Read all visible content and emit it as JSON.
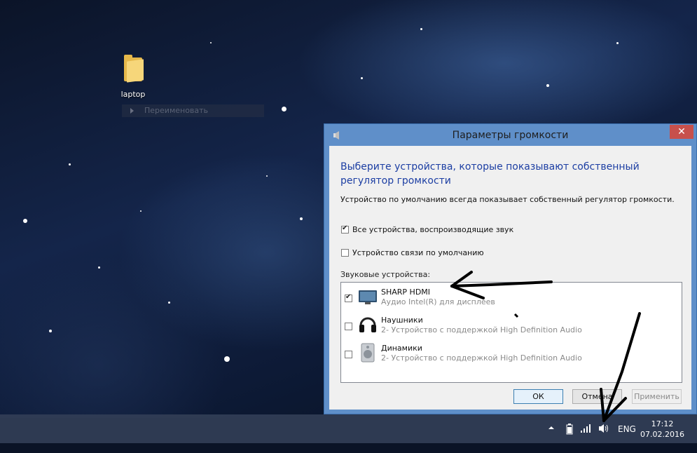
{
  "desktop": {
    "icon_label": "laptop",
    "tooltip": "Переименовать",
    "colors": {
      "sky": "#0b1428",
      "folder": "#e6b84a"
    }
  },
  "dialog": {
    "title": "Параметры громкости",
    "close_glyph": "✕",
    "heading": "Выберите устройства, которые показывают собственный регулятор громкости",
    "description": "Устройство по умолчанию всегда показывает собственный регулятор громкости.",
    "options": [
      {
        "label": "Все устройства, воспроизводящие звук",
        "checked": true
      },
      {
        "label": "Устройство связи по умолчанию",
        "checked": false
      }
    ],
    "devices_label": "Звуковые устройства:",
    "devices": [
      {
        "name": "SHARP HDMI",
        "sub": "Аудио Intel(R) для дисплеев",
        "checked": true,
        "icon": "monitor-icon"
      },
      {
        "name": "Наушники",
        "sub": "2- Устройство с поддержкой High Definition Audio",
        "checked": false,
        "icon": "headphones-icon"
      },
      {
        "name": "Динамики",
        "sub": "2- Устройство с поддержкой High Definition Audio",
        "checked": false,
        "icon": "speaker-icon"
      }
    ],
    "buttons": {
      "ok": "ОК",
      "cancel": "Отмена",
      "apply": "Применить"
    },
    "colors": {
      "frame": "#5f8fc9",
      "heading": "#1c3ea3",
      "close": "#c7504c"
    }
  },
  "taskbar": {
    "language": "ENG",
    "time": "17:12",
    "date": "07.02.2016",
    "tray_icons": [
      "chevron-up-icon",
      "battery-icon",
      "signal-icon",
      "volume-icon"
    ]
  }
}
